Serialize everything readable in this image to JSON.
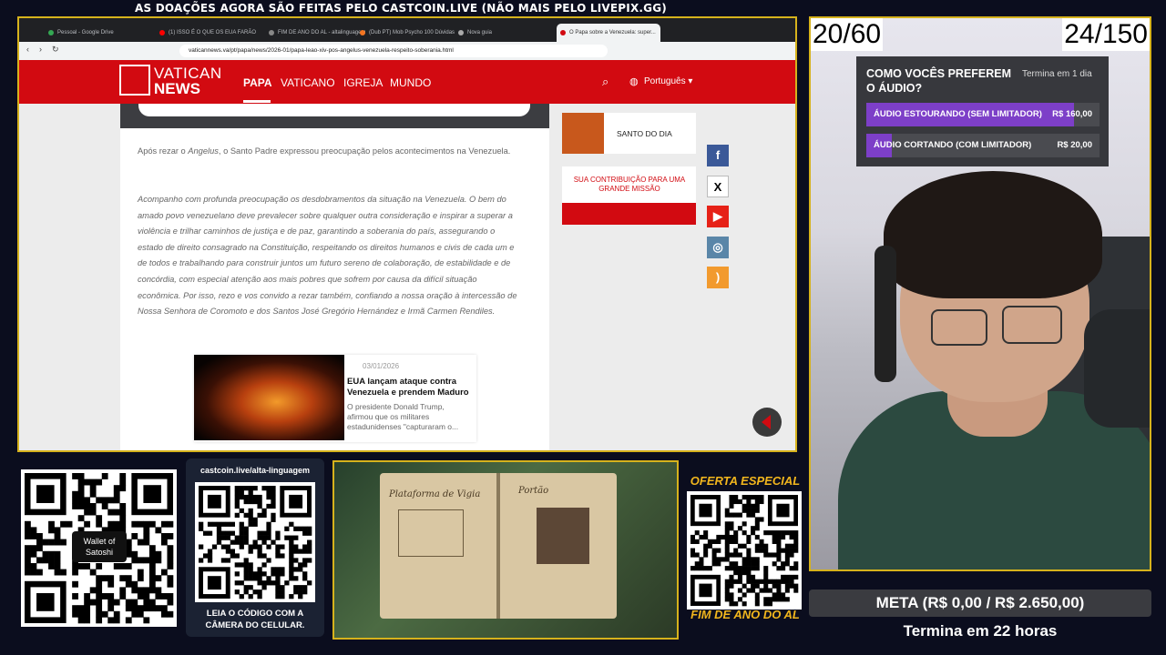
{
  "ticker": "AS DOAÇÕES AGORA SÃO FEITAS PELO CASTCOIN.LIVE (NÃO MAIS PELO LIVEPIX.GG)",
  "browser": {
    "tabs": [
      {
        "label": "Pessoal - Google Drive",
        "color": "#34a853"
      },
      {
        "label": "(1) ISSO É O QUE OS EUA FARÃO",
        "color": "#ff0000"
      },
      {
        "label": "FIM DE ANO DO AL - altalinguagem",
        "color": "#888888"
      },
      {
        "label": "(Dub PT) Mob Psycho 100 Dúvidas",
        "color": "#f47521"
      },
      {
        "label": "Nova guia",
        "color": "#aaaaaa"
      },
      {
        "label": "O Papa sobre a Venezuela: super...",
        "color": "#d20a11",
        "active": true
      }
    ],
    "url": "vaticannews.va/pt/papa/news/2026-01/papa-leao-xiv-pos-angelus-venezuela-respeito-soberania.html"
  },
  "site": {
    "logo_top": "VATICAN",
    "logo_bottom": "NEWS",
    "nav": [
      "PAPA",
      "VATICANO",
      "IGREJA",
      "MUNDO"
    ],
    "language": "Português",
    "para1_pre": "Após rezar o ",
    "para1_em": "Angelus",
    "para1_post": ", o Santo Padre expressou preocupação pelos acontecimentos na Venezuela.",
    "para2": "Acompanho com profunda preocupação os desdobramentos da situação na Venezuela. O bem do amado povo venezuelano deve prevalecer sobre qualquer outra consideração e inspirar a superar a violência e trilhar caminhos de justiça e de paz, garantindo a soberania do país, assegurando o estado de direito consagrado na Constituição, respeitando os direitos humanos e civis de cada um e de todos e trabalhando para construir juntos um futuro sereno de colaboração, de estabilidade e de concórdia, com especial atenção aos mais pobres que sofrem por causa da difícil situação econômica. Por isso, rezo e vos convido a rezar também, confiando a nossa oração à intercessão de Nossa Senhora de Coromoto e dos Santos José Gregório Hernández e Irmã Carmen Rendiles.",
    "card": {
      "date": "03/01/2026",
      "title": "EUA lançam ataque contra Venezuela e prendem Maduro",
      "desc": "O presidente Donald Trump, afirmou que os militares estadunidenses \"capturaram o..."
    },
    "santo": "SANTO DO DIA",
    "contrib": "SUA CONTRIBUIÇÃO PARA UMA GRANDE MISSÃO",
    "social": [
      {
        "icon": "facebook-icon",
        "glyph": "f",
        "bg": "#3b5998",
        "fg": "#ffffff"
      },
      {
        "icon": "x-icon",
        "glyph": "X",
        "bg": "#ffffff",
        "fg": "#000000"
      },
      {
        "icon": "youtube-icon",
        "glyph": "▶",
        "bg": "#e62117",
        "fg": "#ffffff"
      },
      {
        "icon": "instagram-icon",
        "glyph": "◎",
        "bg": "#5a86a8",
        "fg": "#ffffff"
      },
      {
        "icon": "rss-icon",
        "glyph": ")",
        "bg": "#f29a2e",
        "fg": "#ffffff"
      }
    ]
  },
  "counters": {
    "left": "20/60",
    "right": "24/150"
  },
  "poll": {
    "question": "COMO VOCÊS PREFEREM O ÁUDIO?",
    "time": "Termina em 1 dia",
    "options": [
      {
        "label": "ÁUDIO ESTOURANDO (SEM LIMITADOR)",
        "value": "R$ 160,00",
        "fill": 0.89
      },
      {
        "label": "ÁUDIO CORTANDO (COM LIMITADOR)",
        "value": "R$ 20,00",
        "fill": 0.11
      }
    ]
  },
  "meta": {
    "label": "META (R$ 0,00 / R$ 2.650,00)",
    "time": "Termina em 22 horas"
  },
  "wallet": "Wallet of Satoshi",
  "castcoin": {
    "url": "castcoin.live/alta-linguagem",
    "cta": "LEIA O CÓDIGO COM A CÂMERA DO CELULAR."
  },
  "game": {
    "left_title": "Plataforma de Vigia",
    "right_title": "Portão"
  },
  "oferta": {
    "title": "OFERTA ESPECIAL",
    "bottom": "FIM DE ANO DO AL"
  },
  "colors": {
    "accent": "#d6b21c",
    "vatican_red": "#d20a11",
    "poll_fill": "#7d3fc8",
    "oferta": "#f2b61d"
  }
}
